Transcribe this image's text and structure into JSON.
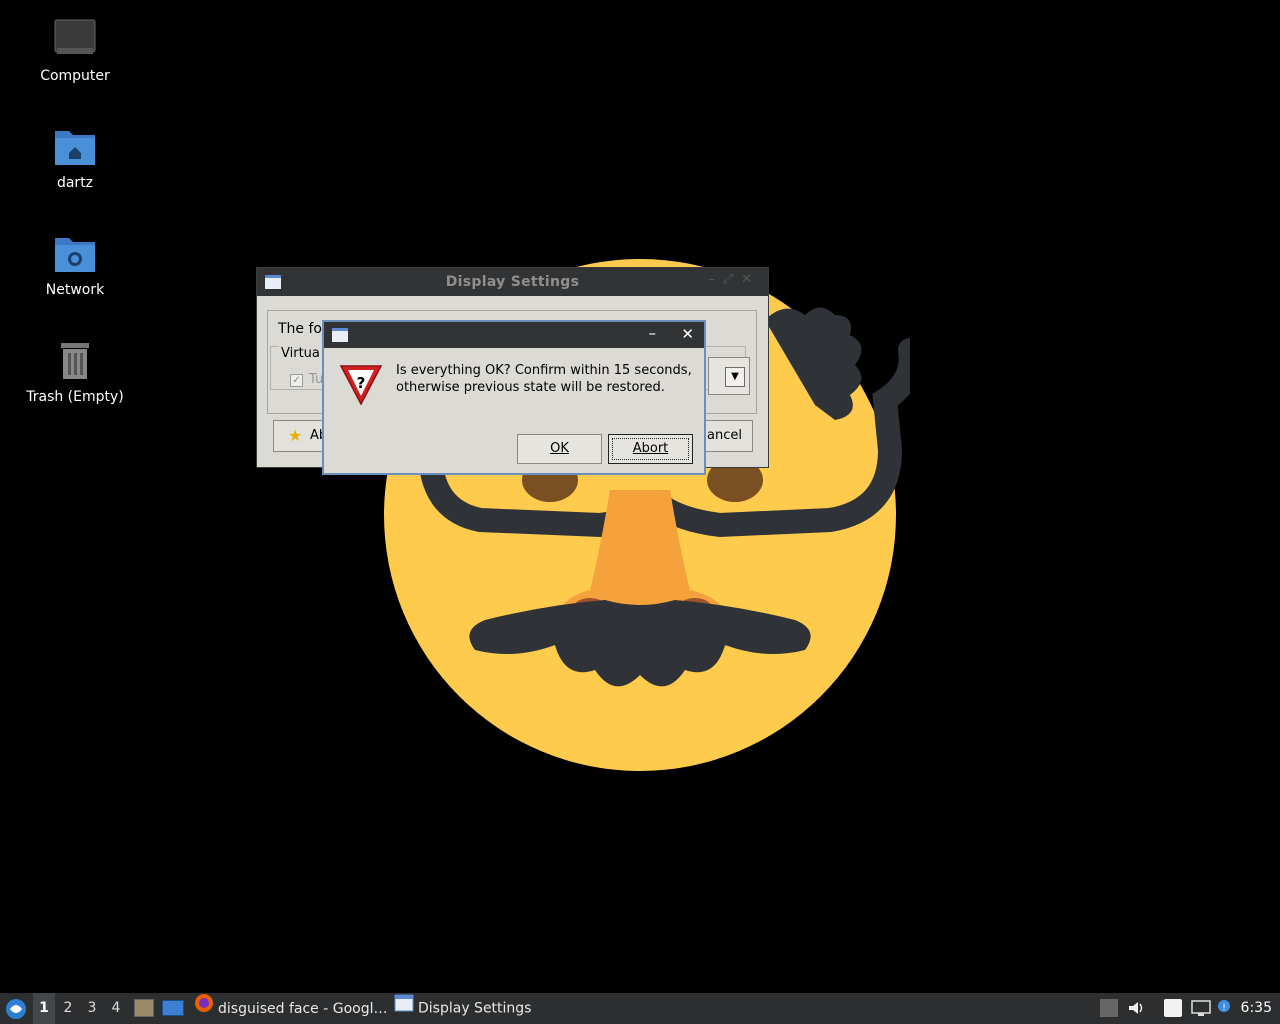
{
  "desktop": {
    "icons": [
      {
        "label": "Computer"
      },
      {
        "label": "dartz"
      },
      {
        "label": "Network"
      },
      {
        "label": "Trash (Empty)"
      }
    ]
  },
  "display_settings": {
    "title": "Display Settings",
    "frame_text": "The fol",
    "group_label": "Virtua",
    "checkbox_label": "Tu",
    "about_label": "Ab",
    "cancel_label": "ancel"
  },
  "confirm_dialog": {
    "minimize_glyph": "–",
    "close_glyph": "✕",
    "message_line1": "Is everything OK? Confirm within 15 seconds,",
    "message_line2": "otherwise previous state will be restored.",
    "ok_label": "OK",
    "abort_label": "Abort"
  },
  "taskbar": {
    "workspaces": [
      "1",
      "2",
      "3",
      "4"
    ],
    "active_workspace": "1",
    "tasks": [
      {
        "label": "disguised face - Googl…",
        "icon": "firefox-icon"
      },
      {
        "label": "Display Settings",
        "icon": "window-icon"
      }
    ],
    "clock": "6:35"
  },
  "colors": {
    "face_yellow": "#fecb4d",
    "glasses_dark": "#2f3237",
    "nose_orange": "#f5a23c",
    "taskbar_bg": "#2c2e30",
    "folder_blue": "#4a90d9"
  }
}
